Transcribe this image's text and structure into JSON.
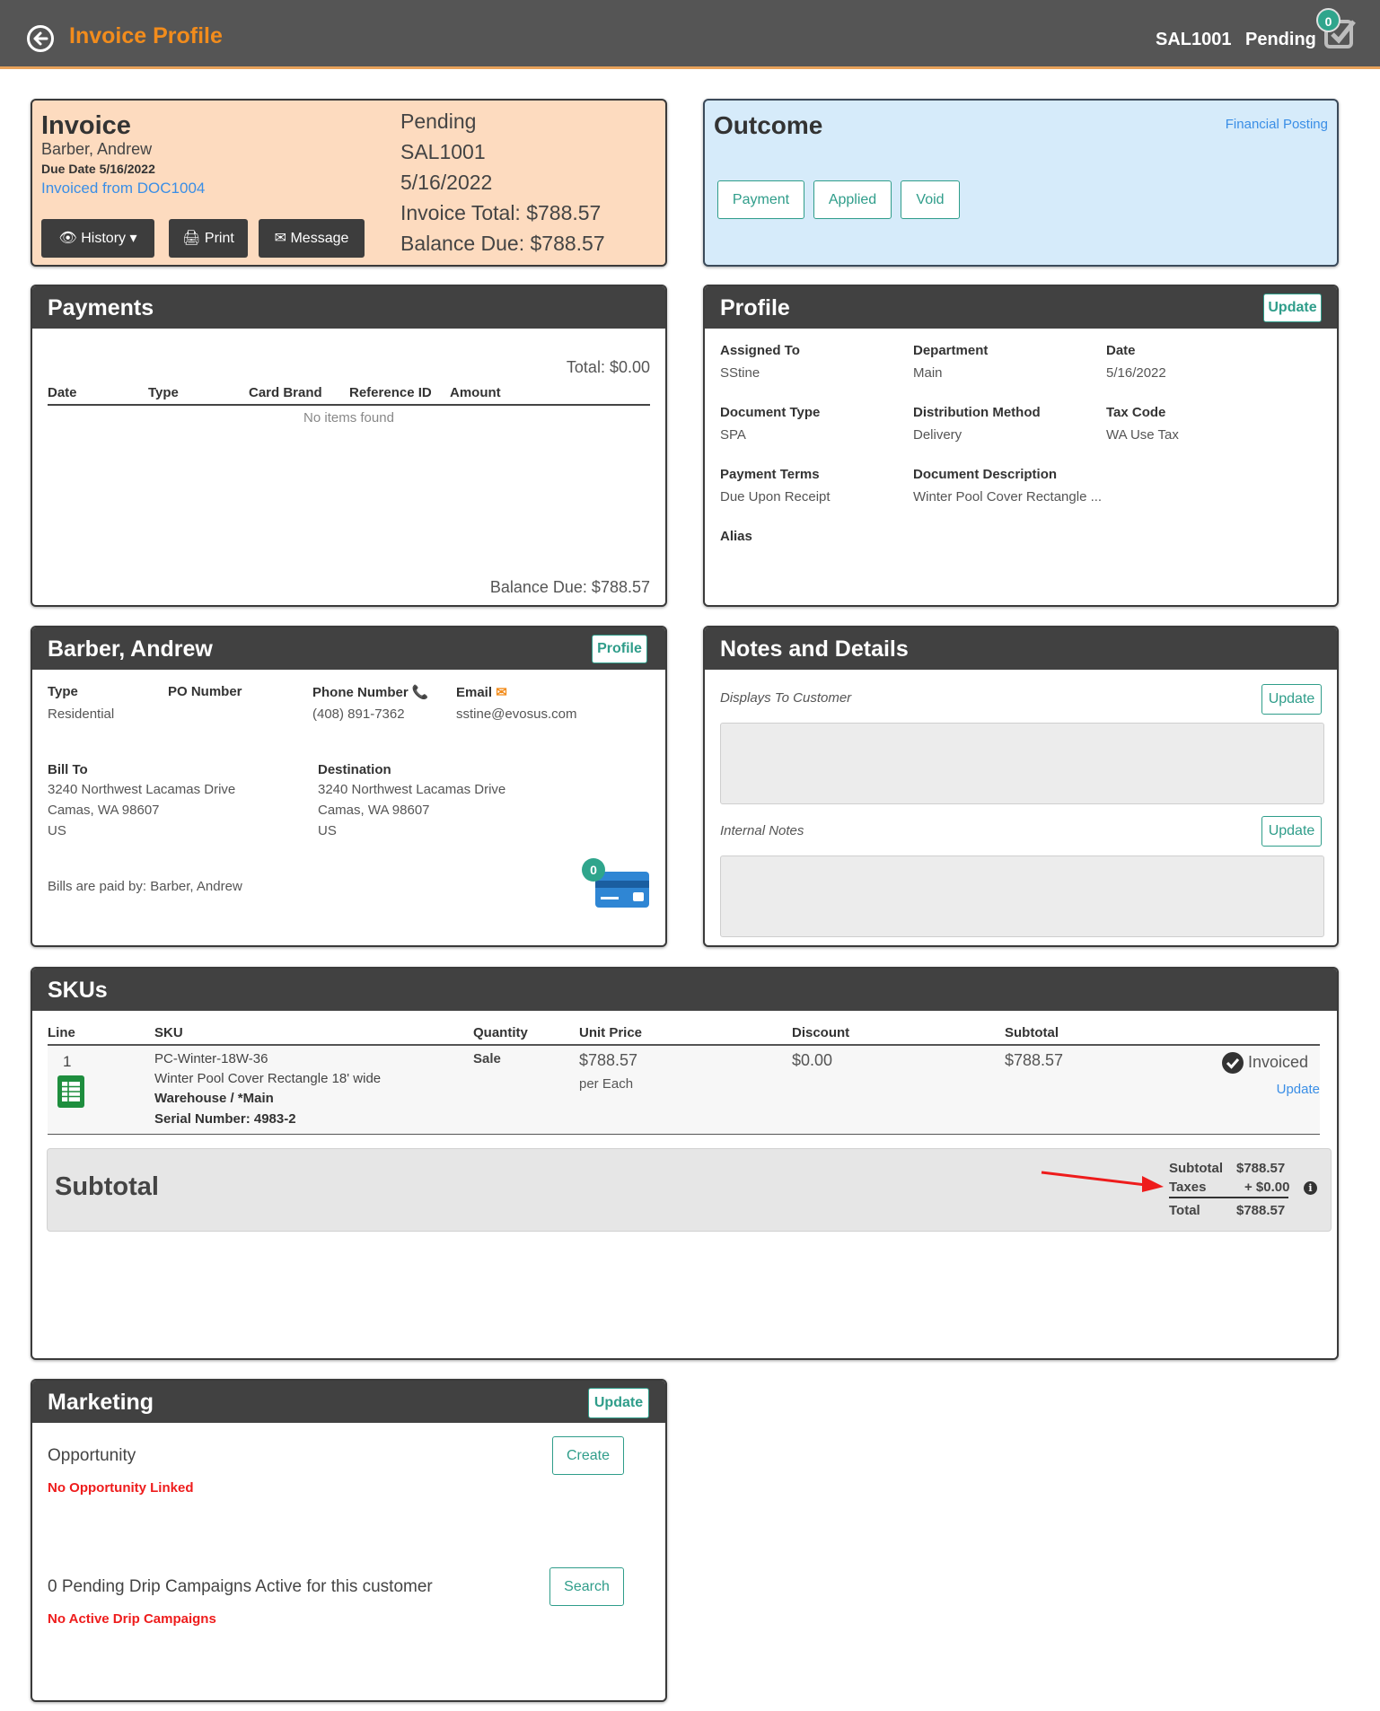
{
  "header": {
    "title": "Invoice Profile",
    "doc_id": "SAL1001",
    "status": "Pending",
    "task_count": "0"
  },
  "invoice": {
    "title": "Invoice",
    "customer": "Barber, Andrew",
    "due_date": "Due Date 5/16/2022",
    "invoiced_from": "Invoiced from DOC1004",
    "status": "Pending",
    "doc_id": "SAL1001",
    "date": "5/16/2022",
    "total": "Invoice Total: $788.57",
    "balance": "Balance Due: $788.57",
    "history_label": "History",
    "print_label": "Print",
    "message_label": "Message"
  },
  "outcome": {
    "title": "Outcome",
    "financial_posting": "Financial Posting",
    "payment_label": "Payment",
    "applied_label": "Applied",
    "void_label": "Void"
  },
  "payments": {
    "title": "Payments",
    "total": "Total: $0.00",
    "columns": [
      "Date",
      "Type",
      "Card Brand",
      "Reference ID",
      "Amount"
    ],
    "empty": "No items found",
    "balance": "Balance Due: $788.57"
  },
  "profile": {
    "title": "Profile",
    "update_label": "Update",
    "assigned_to_label": "Assigned To",
    "assigned_to": "SStine",
    "department_label": "Department",
    "department": "Main",
    "date_label": "Date",
    "date": "5/16/2022",
    "doc_type_label": "Document Type",
    "doc_type": "SPA",
    "distribution_label": "Distribution Method",
    "distribution": "Delivery",
    "tax_code_label": "Tax Code",
    "tax_code": "WA Use Tax",
    "payment_terms_label": "Payment Terms",
    "payment_terms": "Due Upon Receipt",
    "doc_desc_label": "Document Description",
    "doc_desc": "Winter Pool Cover Rectangle ...",
    "alias_label": "Alias"
  },
  "customer": {
    "title": "Barber, Andrew",
    "profile_label": "Profile",
    "type_label": "Type",
    "type": "Residential",
    "po_label": "PO Number",
    "phone_label": "Phone Number",
    "phone": "(408) 891-7362",
    "email_label": "Email",
    "email": "sstine@evosus.com",
    "bill_to_label": "Bill To",
    "bill_to": [
      "3240 Northwest Lacamas Drive",
      "Camas, WA 98607",
      "US"
    ],
    "destination_label": "Destination",
    "destination": [
      "3240 Northwest Lacamas Drive",
      "Camas, WA 98607",
      "US"
    ],
    "paid_by": "Bills are paid by: Barber, Andrew",
    "card_count": "0"
  },
  "notes": {
    "title": "Notes and Details",
    "customer_label": "Displays To Customer",
    "internal_label": "Internal Notes",
    "update_label": "Update"
  },
  "skus": {
    "title": "SKUs",
    "columns": [
      "Line",
      "SKU",
      "Quantity",
      "Unit Price",
      "Discount",
      "Subtotal"
    ],
    "row": {
      "line": "1",
      "sku": "PC-Winter-18W-36",
      "description": "Winter Pool Cover Rectangle 18' wide",
      "warehouse": "Warehouse / *Main",
      "serial": "Serial Number: 4983-2",
      "quantity": "Sale",
      "unit_price": "$788.57",
      "per": "per Each",
      "discount": "$0.00",
      "subtotal": "$788.57",
      "status": "Invoiced",
      "update_label": "Update"
    },
    "subtotal_title": "Subtotal",
    "totals": {
      "subtotal_label": "Subtotal",
      "subtotal": "$788.57",
      "taxes_label": "Taxes",
      "taxes": "+ $0.00",
      "total_label": "Total",
      "total": "$788.57"
    }
  },
  "marketing": {
    "title": "Marketing",
    "update_label": "Update",
    "opportunity_label": "Opportunity",
    "create_label": "Create",
    "no_opportunity": "No Opportunity Linked",
    "drip_label": "0 Pending Drip Campaigns Active for this customer",
    "search_label": "Search",
    "no_drip": "No Active Drip Campaigns"
  },
  "colors": {
    "accent_orange": "#f28c1c",
    "teal": "#2f9d8a",
    "link_blue": "#3a8ee6",
    "alert_red": "#ee1c1c",
    "header_dark": "#414141"
  }
}
